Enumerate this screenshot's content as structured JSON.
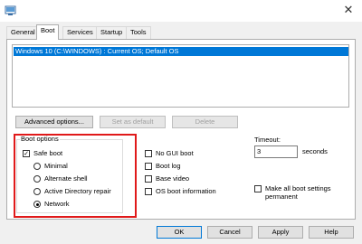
{
  "window": {
    "app_icon": "msconfig-icon",
    "close_icon": "close-icon",
    "close_glyph": "✕"
  },
  "tabs": [
    {
      "label": "General",
      "active": false
    },
    {
      "label": "Boot",
      "active": true
    },
    {
      "label": "Services",
      "active": false
    },
    {
      "label": "Startup",
      "active": false
    },
    {
      "label": "Tools",
      "active": false
    }
  ],
  "os_list": {
    "items": [
      "Windows 10 (C:\\WINDOWS) : Current OS; Default OS"
    ],
    "selected_index": 0
  },
  "actions": {
    "advanced_options": "Advanced options...",
    "set_as_default": "Set as default",
    "delete": "Delete"
  },
  "boot_options": {
    "title": "Boot options",
    "safe_boot": {
      "label": "Safe boot",
      "checked": true
    },
    "safe_boot_modes": [
      {
        "label": "Minimal",
        "selected": false
      },
      {
        "label": "Alternate shell",
        "selected": false
      },
      {
        "label": "Active Directory repair",
        "selected": false
      },
      {
        "label": "Network",
        "selected": true
      }
    ],
    "flags": [
      {
        "label": "No GUI boot",
        "checked": false
      },
      {
        "label": "Boot log",
        "checked": false
      },
      {
        "label": "Base video",
        "checked": false
      },
      {
        "label": "OS boot information",
        "checked": false
      }
    ]
  },
  "timeout": {
    "label": "Timeout:",
    "value": "3",
    "unit": "seconds"
  },
  "make_permanent": {
    "label_line1": "Make all boot settings",
    "label_line2": "permanent",
    "checked": false
  },
  "footer": {
    "ok": "OK",
    "cancel": "Cancel",
    "apply": "Apply",
    "help": "Help"
  },
  "colors": {
    "accent": "#0078d7",
    "highlight_frame": "#e0191a",
    "dialog_bg": "#f0f0f0",
    "panel_bg": "#ffffff"
  }
}
